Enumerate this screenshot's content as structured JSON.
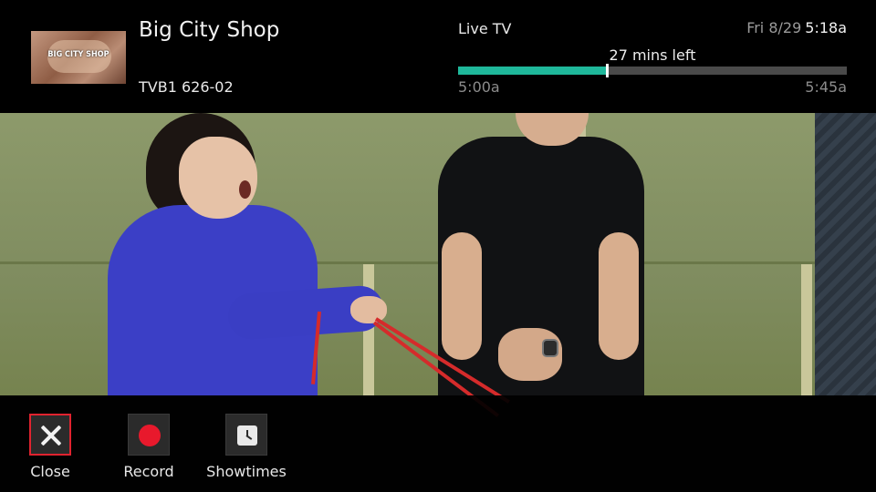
{
  "program": {
    "thumbnail_text": "BIG CITY SHOP",
    "title": "Big City Shop",
    "channel": "TVB1 626-02"
  },
  "status": {
    "source_label": "Live TV",
    "date": "Fri 8/29",
    "time": "5:18a"
  },
  "progress": {
    "remaining_label": "27 mins left",
    "start_time": "5:00a",
    "end_time": "5:45a",
    "fraction_elapsed": 0.383,
    "fill_color": "#1fb89b"
  },
  "actions": [
    {
      "label": "Close",
      "icon": "close-icon",
      "focused": true
    },
    {
      "label": "Record",
      "icon": "record-icon",
      "focused": false
    },
    {
      "label": "Showtimes",
      "icon": "clock-icon",
      "focused": false
    }
  ],
  "colors": {
    "focus_border": "#e0232f",
    "record_dot": "#e8192c"
  }
}
